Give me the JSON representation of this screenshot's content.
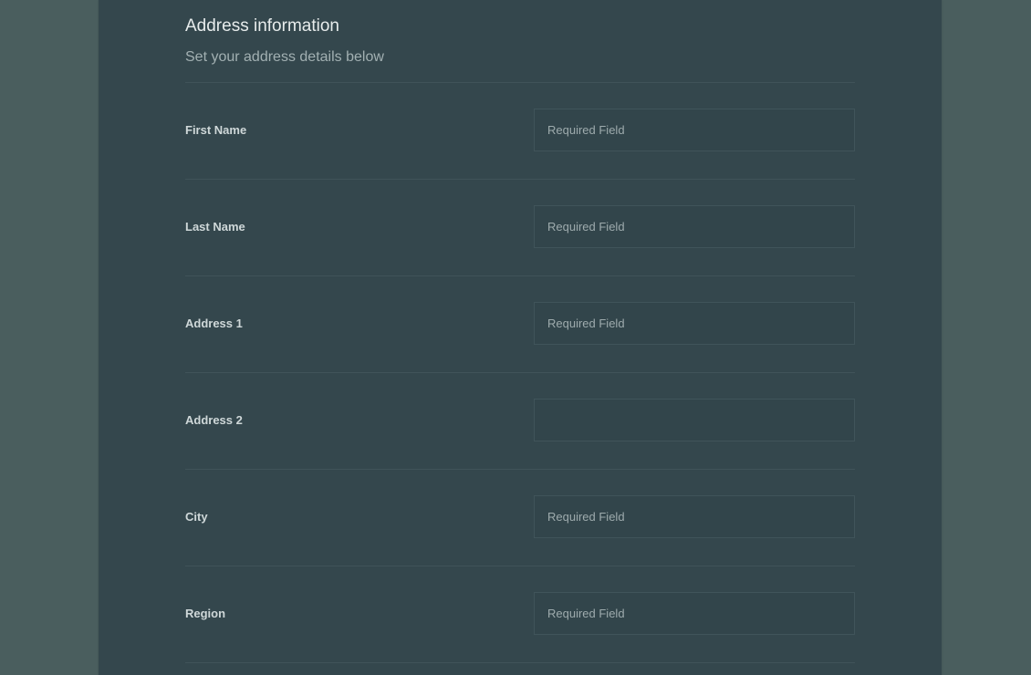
{
  "section": {
    "title": "Address information",
    "subtitle": "Set your address details below"
  },
  "fields": [
    {
      "label": "First Name",
      "value": "",
      "placeholder": "Required Field"
    },
    {
      "label": "Last Name",
      "value": "",
      "placeholder": "Required Field"
    },
    {
      "label": "Address 1",
      "value": "",
      "placeholder": "Required Field"
    },
    {
      "label": "Address 2",
      "value": "",
      "placeholder": ""
    },
    {
      "label": "City",
      "value": "",
      "placeholder": "Required Field"
    },
    {
      "label": "Region",
      "value": "",
      "placeholder": "Required Field"
    }
  ],
  "colors": {
    "page_background": "#4a5e5e",
    "panel_background": "#34474d",
    "divider": "#405359",
    "title_text": "#e7ecec",
    "subtitle_text": "#a2b0b2",
    "label_text": "#cfd8d9",
    "placeholder_text": "#9eabad"
  }
}
